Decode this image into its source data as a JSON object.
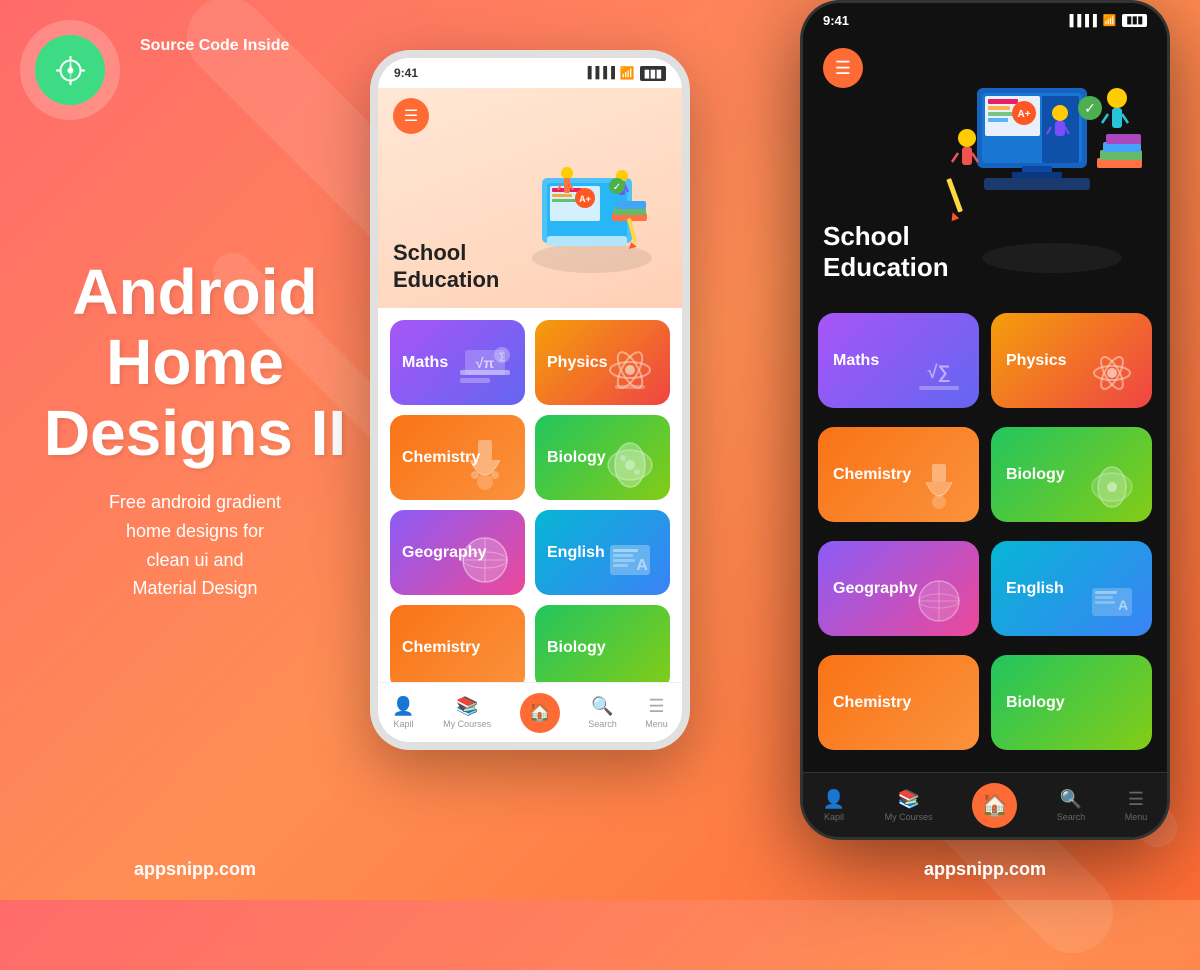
{
  "background": {
    "gradient_start": "#ff6b6b",
    "gradient_end": "#ff6b35"
  },
  "left_panel": {
    "logo_icon": "⚙",
    "source_code_label": "Source Code\nInside",
    "main_title": "Android\nHome\nDesigns II",
    "description": "Free android gradient\nhome designs for\nclean ui and\nMaterial Design",
    "website": "appsnipp.com"
  },
  "phone_light": {
    "status_time": "9:41",
    "menu_icon": "☰",
    "school_title_line1": "School",
    "school_title_line2": "Education",
    "courses": [
      {
        "label": "Maths",
        "gradient": "card-maths"
      },
      {
        "label": "Physics",
        "gradient": "card-physics"
      },
      {
        "label": "Chemistry",
        "gradient": "card-chemistry"
      },
      {
        "label": "Biology",
        "gradient": "card-biology"
      },
      {
        "label": "Geography",
        "gradient": "card-geography"
      },
      {
        "label": "English",
        "gradient": "card-english"
      },
      {
        "label": "Chemistry",
        "gradient": "card-chemistry"
      },
      {
        "label": "Biology",
        "gradient": "card-biology"
      }
    ],
    "nav_items": [
      {
        "label": "Kapil",
        "icon": "👤",
        "active": false
      },
      {
        "label": "My Courses",
        "icon": "📚",
        "active": false
      },
      {
        "label": "",
        "icon": "🏠",
        "active": true
      },
      {
        "label": "Search",
        "icon": "🔍",
        "active": false
      },
      {
        "label": "Menu",
        "icon": "☰",
        "active": false
      }
    ]
  },
  "phone_dark": {
    "status_time": "9:41",
    "menu_icon": "☰",
    "school_title_line1": "School",
    "school_title_line2": "Education",
    "courses": [
      {
        "label": "Maths",
        "gradient": "card-maths"
      },
      {
        "label": "Physics",
        "gradient": "card-physics"
      },
      {
        "label": "Chemistry",
        "gradient": "card-chemistry"
      },
      {
        "label": "Biology",
        "gradient": "card-biology"
      },
      {
        "label": "Geography",
        "gradient": "card-geography"
      },
      {
        "label": "English",
        "gradient": "card-english"
      },
      {
        "label": "Chemistry",
        "gradient": "card-chemistry"
      },
      {
        "label": "Biology",
        "gradient": "card-biology"
      }
    ],
    "nav_items": [
      {
        "label": "Kapil",
        "icon": "👤",
        "active": false
      },
      {
        "label": "My Courses",
        "icon": "📚",
        "active": false
      },
      {
        "label": "",
        "icon": "🏠",
        "active": true
      },
      {
        "label": "Search",
        "icon": "🔍",
        "active": false
      },
      {
        "label": "Menu",
        "icon": "☰",
        "active": false
      }
    ]
  },
  "footer": {
    "website_left": "appsnipp.com",
    "website_right": "appsnipp.com"
  }
}
